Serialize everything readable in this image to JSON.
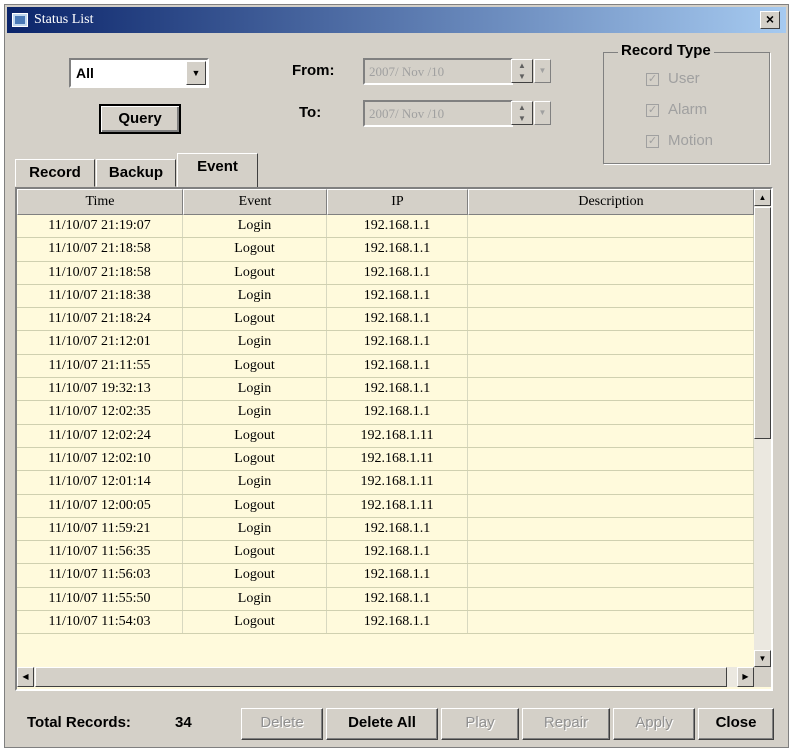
{
  "window": {
    "title": "Status List",
    "close_glyph": "×"
  },
  "filter": {
    "combo_value": "All",
    "query_label": "Query",
    "from_label": "From:",
    "from_value": "2007/ Nov /10",
    "to_label": "To:",
    "to_value": "2007/ Nov /10"
  },
  "record_type": {
    "label": "Record Type",
    "options": [
      {
        "label": "User",
        "checked": true
      },
      {
        "label": "Alarm",
        "checked": true
      },
      {
        "label": "Motion",
        "checked": true
      }
    ]
  },
  "tabs": [
    {
      "label": "Record",
      "active": false
    },
    {
      "label": "Backup",
      "active": false
    },
    {
      "label": "Event",
      "active": true
    }
  ],
  "table": {
    "columns": [
      "Time",
      "Event",
      "IP",
      "Description"
    ],
    "rows": [
      [
        "11/10/07 21:19:07",
        "Login",
        "192.168.1.1",
        ""
      ],
      [
        "11/10/07 21:18:58",
        "Logout",
        "192.168.1.1",
        ""
      ],
      [
        "11/10/07 21:18:58",
        "Logout",
        "192.168.1.1",
        ""
      ],
      [
        "11/10/07 21:18:38",
        "Login",
        "192.168.1.1",
        ""
      ],
      [
        "11/10/07 21:18:24",
        "Logout",
        "192.168.1.1",
        ""
      ],
      [
        "11/10/07 21:12:01",
        "Login",
        "192.168.1.1",
        ""
      ],
      [
        "11/10/07 21:11:55",
        "Logout",
        "192.168.1.1",
        ""
      ],
      [
        "11/10/07 19:32:13",
        "Login",
        "192.168.1.1",
        ""
      ],
      [
        "11/10/07 12:02:35",
        "Login",
        "192.168.1.1",
        ""
      ],
      [
        "11/10/07 12:02:24",
        "Logout",
        "192.168.1.11",
        ""
      ],
      [
        "11/10/07 12:02:10",
        "Logout",
        "192.168.1.11",
        ""
      ],
      [
        "11/10/07 12:01:14",
        "Login",
        "192.168.1.11",
        ""
      ],
      [
        "11/10/07 12:00:05",
        "Logout",
        "192.168.1.11",
        ""
      ],
      [
        "11/10/07 11:59:21",
        "Login",
        "192.168.1.1",
        ""
      ],
      [
        "11/10/07 11:56:35",
        "Logout",
        "192.168.1.1",
        ""
      ],
      [
        "11/10/07 11:56:03",
        "Logout",
        "192.168.1.1",
        ""
      ],
      [
        "11/10/07 11:55:50",
        "Login",
        "192.168.1.1",
        ""
      ],
      [
        "11/10/07 11:54:03",
        "Logout",
        "192.168.1.1",
        ""
      ]
    ]
  },
  "footer": {
    "total_label": "Total Records:",
    "total_value": "34",
    "buttons": [
      {
        "label": "Delete",
        "enabled": false
      },
      {
        "label": "Delete All",
        "enabled": true
      },
      {
        "label": "Play",
        "enabled": false
      },
      {
        "label": "Repair",
        "enabled": false
      },
      {
        "label": "Apply",
        "enabled": false
      },
      {
        "label": "Close",
        "enabled": true
      }
    ]
  },
  "colors": {
    "list_background": "#fffadc",
    "dialog_face": "#d4d0c8",
    "title_start": "#0a246a",
    "title_end": "#a6caf0"
  },
  "icons": {
    "title": "app-window-icon",
    "checkbox": "checkmark-icon"
  }
}
